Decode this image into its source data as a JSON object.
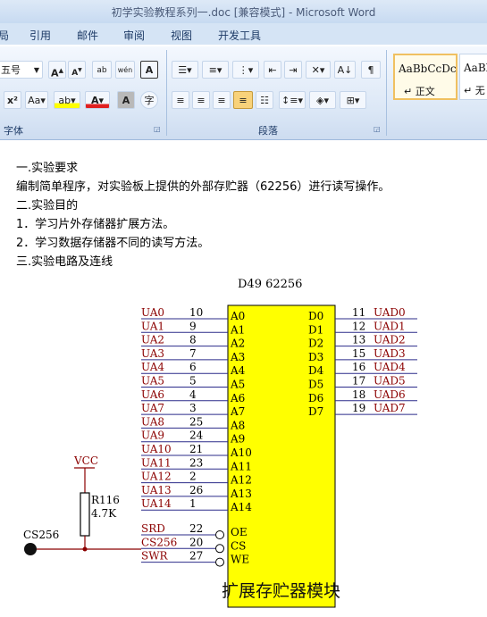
{
  "window": {
    "title": "初学实验教程系列一.doc [兼容模式] - Microsoft Word"
  },
  "tabs": [
    {
      "label": "局"
    },
    {
      "label": "引用"
    },
    {
      "label": "邮件"
    },
    {
      "label": "审阅"
    },
    {
      "label": "视图"
    },
    {
      "label": "开发工具"
    }
  ],
  "ribbon": {
    "font_size": "五号",
    "groups": {
      "font": "字体",
      "paragraph": "段落"
    },
    "styles": [
      {
        "sample": "AaBbCcDc",
        "name": "↵ 正文"
      },
      {
        "sample": "AaBb",
        "name": "↵ 无"
      }
    ],
    "icons": [
      "grow-font-icon",
      "shrink-font-icon",
      "phonetic-guide-icon",
      "wen-icon",
      "character-border-icon",
      "superscript-icon",
      "change-case-icon",
      "highlight-icon",
      "font-color-icon",
      "character-shading-icon",
      "enclose-character-icon",
      "bullets-icon",
      "numbering-icon",
      "multilevel-list-icon",
      "decrease-indent-icon",
      "increase-indent-icon",
      "chinese-layout-icon",
      "sort-icon",
      "show-marks-icon",
      "align-left-icon",
      "center-icon",
      "align-right-icon",
      "justify-icon",
      "distributed-icon",
      "line-spacing-icon",
      "shading-icon",
      "borders-icon"
    ]
  },
  "document": {
    "lines": [
      "一.实验要求",
      "编制简单程序，对实验板上提供的外部存贮器（62256）进行读写操作。",
      "二.实验目的",
      "1．学习片外存储器扩展方法。",
      "2．学习数据存储器不同的读写方法。",
      "三.实验电路及连线"
    ]
  },
  "circuit": {
    "chip_title": "D49  62256",
    "left_pins": [
      {
        "net": "UA0",
        "num": "10",
        "pin": "A0"
      },
      {
        "net": "UA1",
        "num": "9",
        "pin": "A1"
      },
      {
        "net": "UA2",
        "num": "8",
        "pin": "A2"
      },
      {
        "net": "UA3",
        "num": "7",
        "pin": "A3"
      },
      {
        "net": "UA4",
        "num": "6",
        "pin": "A4"
      },
      {
        "net": "UA5",
        "num": "5",
        "pin": "A5"
      },
      {
        "net": "UA6",
        "num": "4",
        "pin": "A6"
      },
      {
        "net": "UA7",
        "num": "3",
        "pin": "A7"
      },
      {
        "net": "UA8",
        "num": "25",
        "pin": "A8"
      },
      {
        "net": "UA9",
        "num": "24",
        "pin": "A9"
      },
      {
        "net": "UA10",
        "num": "21",
        "pin": "A10"
      },
      {
        "net": "UA11",
        "num": "23",
        "pin": "A11"
      },
      {
        "net": "UA12",
        "num": "2",
        "pin": "A12"
      },
      {
        "net": "UA13",
        "num": "26",
        "pin": "A13"
      },
      {
        "net": "UA14",
        "num": "1",
        "pin": "A14"
      }
    ],
    "right_pins": [
      {
        "pin": "D0",
        "num": "11",
        "net": "UAD0"
      },
      {
        "pin": "D1",
        "num": "12",
        "net": "UAD1"
      },
      {
        "pin": "D2",
        "num": "13",
        "net": "UAD2"
      },
      {
        "pin": "D3",
        "num": "15",
        "net": "UAD3"
      },
      {
        "pin": "D4",
        "num": "16",
        "net": "UAD4"
      },
      {
        "pin": "D5",
        "num": "17",
        "net": "UAD5"
      },
      {
        "pin": "D6",
        "num": "18",
        "net": "UAD6"
      },
      {
        "pin": "D7",
        "num": "19",
        "net": "UAD7"
      }
    ],
    "control_pins": [
      {
        "net": "SRD",
        "num": "22",
        "pin": "OE"
      },
      {
        "net": "CS256",
        "num": "20",
        "pin": "CS"
      },
      {
        "net": "SWR",
        "num": "27",
        "pin": "WE"
      }
    ],
    "vcc": "VCC",
    "resistor_name": "R116",
    "resistor_value": "4.7K",
    "cs_label": "CS256",
    "module_caption": "扩展存贮器模块",
    "colors": {
      "net_label": "#8b0000",
      "net_line": "#2b2b8a",
      "chip_fill": "#ffff00",
      "wire": "#8b0000"
    }
  }
}
